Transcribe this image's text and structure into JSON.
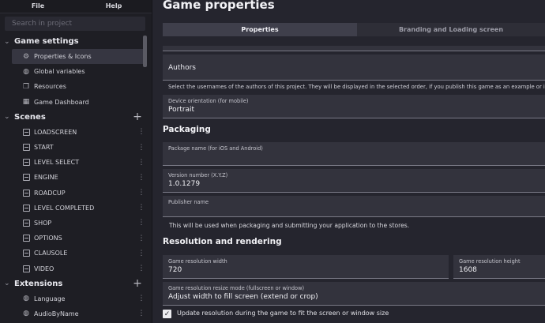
{
  "menubar": {
    "file": "File",
    "help": "Help"
  },
  "search": {
    "placeholder": "Search in project"
  },
  "game_settings": {
    "title": "Game settings",
    "items": [
      {
        "label": "Properties & Icons",
        "icon": "gear-icon",
        "active": true
      },
      {
        "label": "Global variables",
        "icon": "globe-icon"
      },
      {
        "label": "Resources",
        "icon": "resources-icon"
      },
      {
        "label": "Game Dashboard",
        "icon": "dashboard-icon"
      }
    ]
  },
  "scenes": {
    "title": "Scenes",
    "items": [
      "LOADSCREEN",
      "START",
      "LEVEL SELECT",
      "ENGINE",
      "ROADCUP",
      "LEVEL COMPLETED",
      "SHOP",
      "OPTIONS",
      "CLAUSOLE",
      "VIDEO"
    ]
  },
  "extensions": {
    "title": "Extensions",
    "items": [
      "Language",
      "AudioByName"
    ]
  },
  "main": {
    "title": "Game properties",
    "tabs": [
      "Properties",
      "Branding and Loading screen"
    ],
    "authors_label": "Authors",
    "authors_help": "Select the usernames of the authors of this project. They will be displayed in the selected order, if you publish this game as an example or in the c",
    "orientation": {
      "label": "Device orientation (for mobile)",
      "value": "Portrait"
    },
    "packaging_title": "Packaging",
    "package_name": {
      "label": "Package name (for iOS and Android)",
      "value": ""
    },
    "version": {
      "label": "Version number (X.Y.Z)",
      "value": "1.0.1279"
    },
    "publisher": {
      "label": "Publisher name",
      "value": ""
    },
    "publisher_help": "This will be used when packaging and submitting your application to the stores.",
    "resolution_title": "Resolution and rendering",
    "width": {
      "label": "Game resolution width",
      "value": "720"
    },
    "height": {
      "label": "Game resolution height",
      "value": "1608"
    },
    "resize": {
      "label": "Game resolution resize mode (fullscreen or window)",
      "value": "Adjust width to fill screen (extend or crop)"
    },
    "update_resolution": {
      "label": "Update resolution during the game to fit the screen or window size",
      "checked": true
    }
  }
}
